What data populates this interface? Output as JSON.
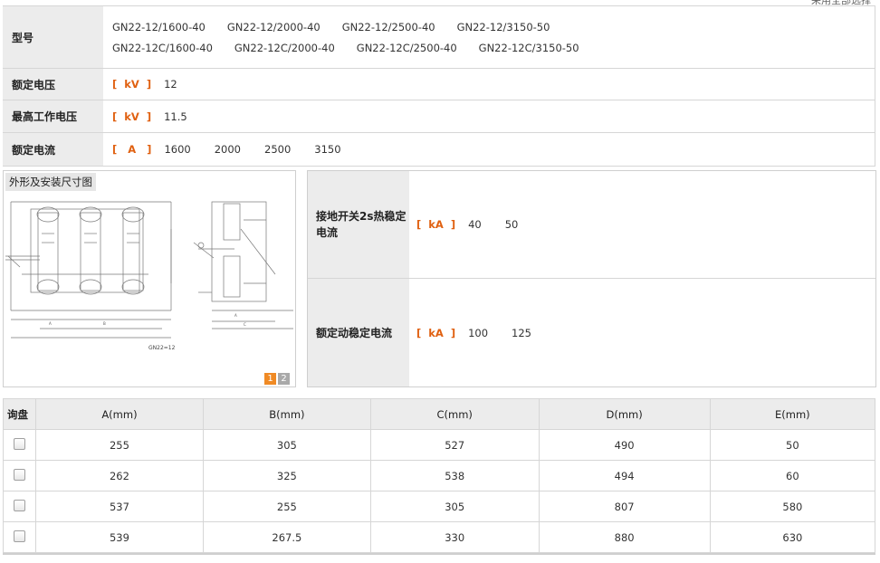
{
  "top_link": "采用全部选择",
  "spec": {
    "model_label": "型号",
    "models": [
      "GN22-12/1600-40",
      "GN22-12/2000-40",
      "GN22-12/2500-40",
      "GN22-12/3150-50",
      "GN22-12C/1600-40",
      "GN22-12C/2000-40",
      "GN22-12C/2500-40",
      "GN22-12C/3150-50"
    ],
    "rated_voltage_label": "额定电压",
    "rated_voltage_unit": "[  kV  ]",
    "rated_voltage_values": [
      "12"
    ],
    "max_voltage_label": "最高工作电压",
    "max_voltage_unit": "[  kV  ]",
    "max_voltage_values": [
      "11.5"
    ],
    "rated_current_label": "额定电流",
    "rated_current_unit": "[   A   ]",
    "rated_current_values": [
      "1600",
      "2000",
      "2500",
      "3150"
    ]
  },
  "image_panel": {
    "caption": "外形及安装尺寸图",
    "drawing_label": "GN22=12",
    "pages": [
      "1",
      "2"
    ]
  },
  "params": {
    "thermal_label": "接地开关2s热稳定电流",
    "thermal_unit": "[  kA  ]",
    "thermal_values": [
      "40",
      "50"
    ],
    "dynamic_label": "额定动稳定电流",
    "dynamic_unit": "[  kA  ]",
    "dynamic_values": [
      "100",
      "125"
    ]
  },
  "dims": {
    "headers": [
      "询盘",
      "A(mm)",
      "B(mm)",
      "C(mm)",
      "D(mm)",
      "E(mm)"
    ],
    "rows": [
      [
        "255",
        "305",
        "527",
        "490",
        "50"
      ],
      [
        "262",
        "325",
        "538",
        "494",
        "60"
      ],
      [
        "537",
        "255",
        "305",
        "807",
        "580"
      ],
      [
        "539",
        "267.5",
        "330",
        "880",
        "630"
      ]
    ]
  }
}
